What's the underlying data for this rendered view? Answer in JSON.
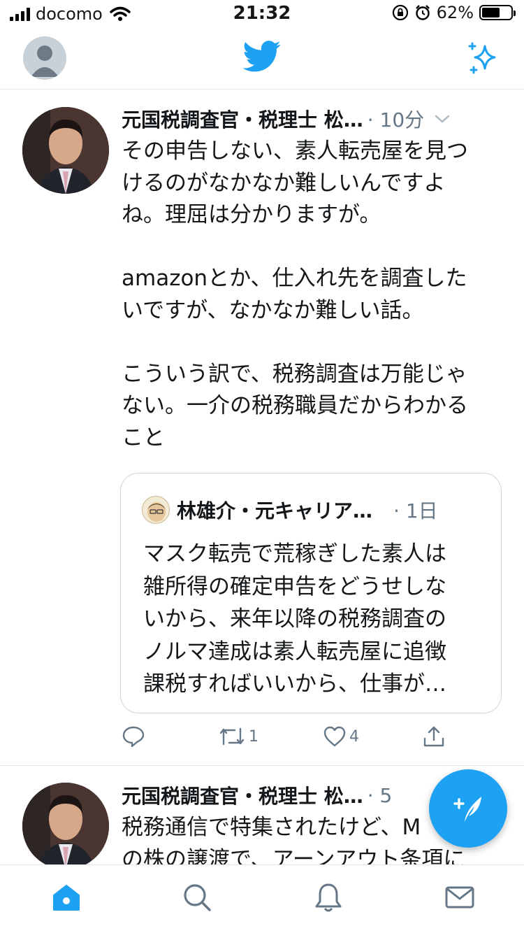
{
  "status_bar": {
    "carrier": "docomo",
    "time": "21:32",
    "battery": "62%",
    "battery_level": 0.62
  },
  "header": {
    "profile_icon": "profile-avatar",
    "logo_icon": "twitter-bird-icon",
    "sparkle_icon": "sparkle-icon",
    "brand_color": "#1da1f2"
  },
  "tweets": [
    {
      "author": "元国税調査官・税理士 松…",
      "time": "· 10分",
      "text": "その申告しない、素人転売屋を見つ\nけるのがなかなか難しいんですよ\nね。理屈は分かりますが。\n\namazonとか、仕入れ先を調査した\nいですが、なかなか難しい話。\n\nこういう訳で、税務調査は万能じゃ\nない。一介の税務職員だからわかる\nこと",
      "quote": {
        "author": "林雄介・元キャリア…",
        "time": "· 1日",
        "text": "マスク転売で荒稼ぎした素人は\n雑所得の確定申告をどうせしな\nいから、来年以降の税務調査の\nノルマ達成は素人転売屋に追徴\n課税すればいいから、仕事が…"
      },
      "actions": {
        "reply_count": "",
        "retweet_count": "1",
        "like_count": "4"
      }
    },
    {
      "author": "元国税調査官・税理士 松…",
      "time": "· 5",
      "text": "税務通信で特集されたけど、M\nの株の譲渡で、アーンアウト条項に"
    }
  ],
  "tab_bar": {
    "items": [
      "home-icon",
      "search-icon",
      "notifications-icon",
      "messages-icon"
    ]
  }
}
